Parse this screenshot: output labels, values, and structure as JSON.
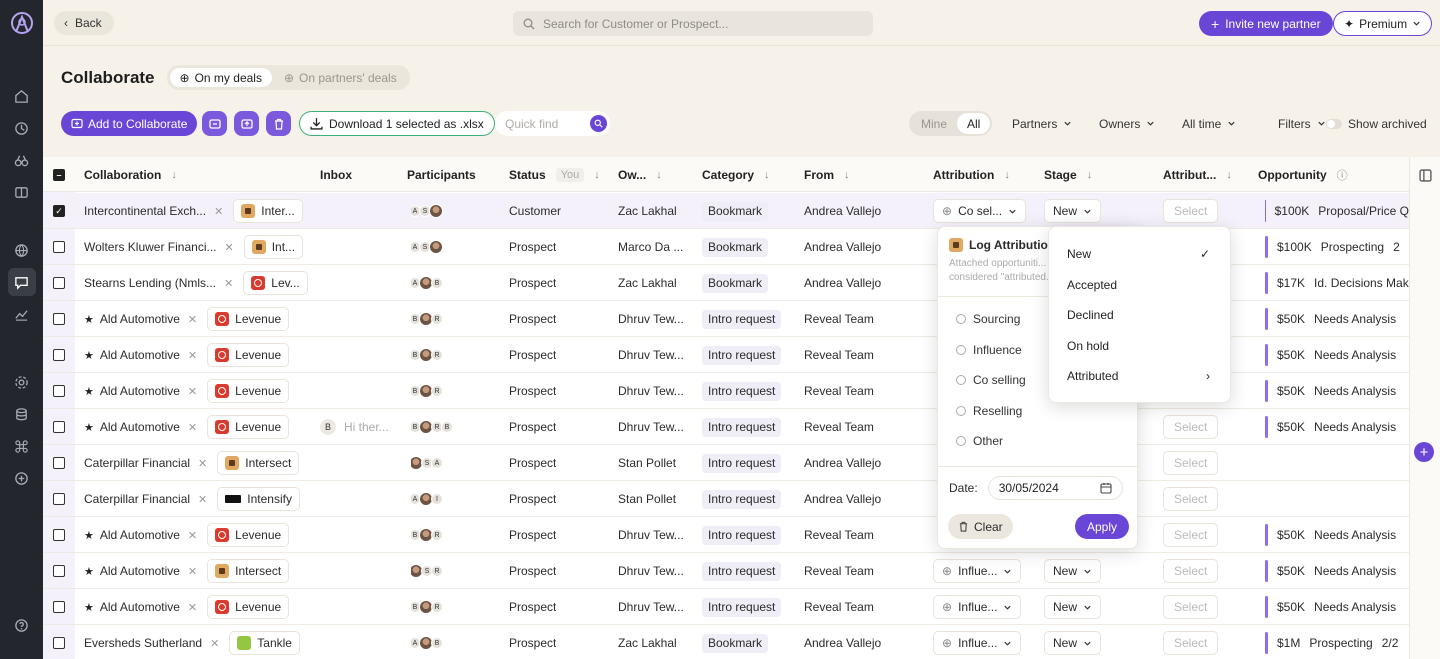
{
  "topbar": {
    "back": "Back",
    "search_placeholder": "Search for Customer or Prospect...",
    "invite": "Invite new partner",
    "premium": "Premium"
  },
  "page": {
    "title": "Collaborate",
    "tabs": [
      {
        "label": "On my deals",
        "active": true
      },
      {
        "label": "On partners' deals",
        "active": false
      }
    ]
  },
  "toolbar": {
    "add": "Add to Collaborate",
    "download": "Download 1 selected as .xlsx",
    "quickfind_placeholder": "Quick find",
    "mine": "Mine",
    "all": "All",
    "partners": "Partners",
    "owners": "Owners",
    "time": "All time",
    "filters": "Filters",
    "archived": "Show archived"
  },
  "columns": {
    "collaboration": "Collaboration",
    "inbox": "Inbox",
    "participants": "Participants",
    "status": "Status",
    "you": "You",
    "owner": "Ow...",
    "category": "Category",
    "from": "From",
    "attribution": "Attribution",
    "stage": "Stage",
    "attributed": "Attribut...",
    "opportunity": "Opportunity"
  },
  "rows": [
    {
      "name": "Intercontinental Exch...",
      "star": false,
      "partner": "Inter...",
      "logo": "int",
      "avatars": [
        "A",
        "S",
        "ph"
      ],
      "status": "Customer",
      "owner": "Zac Lakhal",
      "category": "Bookmark",
      "from": "Andrea Vallejo",
      "attribution": "Co sel...",
      "stage": "New",
      "attributed": "Select",
      "amount": "$100K",
      "opp_stage": "Proposal/Price Q",
      "inbox": "",
      "selected": true
    },
    {
      "name": "Wolters Kluwer Financi...",
      "star": false,
      "partner": "Int...",
      "logo": "int",
      "avatars": [
        "A",
        "S",
        "ph"
      ],
      "status": "Prospect",
      "owner": "Marco Da ...",
      "category": "Bookmark",
      "from": "Andrea Vallejo",
      "attribution": "",
      "stage": "",
      "attributed": "",
      "amount": "$100K",
      "opp_stage": "Prospecting",
      "extra": "2",
      "inbox": "",
      "selected": false
    },
    {
      "name": "Stearns Lending (Nmls...",
      "star": false,
      "partner": "Lev...",
      "logo": "lev",
      "avatars": [
        "A",
        "ph",
        "B"
      ],
      "status": "Prospect",
      "owner": "Zac Lakhal",
      "category": "Bookmark",
      "from": "Andrea Vallejo",
      "attribution": "",
      "stage": "",
      "attributed": "",
      "amount": "$17K",
      "opp_stage": "Id. Decisions Mak",
      "inbox": "",
      "selected": false
    },
    {
      "name": "Ald Automotive",
      "star": true,
      "partner": "Levenue",
      "logo": "lev",
      "avatars": [
        "B",
        "ph",
        "R"
      ],
      "status": "Prospect",
      "owner": "Dhruv Tew...",
      "category": "Intro request",
      "from": "Reveal Team",
      "attribution": "",
      "stage": "",
      "attributed": "",
      "amount": "$50K",
      "opp_stage": "Needs Analysis",
      "inbox": "",
      "selected": false
    },
    {
      "name": "Ald Automotive",
      "star": true,
      "partner": "Levenue",
      "logo": "lev",
      "avatars": [
        "B",
        "ph",
        "R"
      ],
      "status": "Prospect",
      "owner": "Dhruv Tew...",
      "category": "Intro request",
      "from": "Reveal Team",
      "attribution": "",
      "stage": "",
      "attributed": "",
      "amount": "$50K",
      "opp_stage": "Needs Analysis",
      "inbox": "",
      "selected": false
    },
    {
      "name": "Ald Automotive",
      "star": true,
      "partner": "Levenue",
      "logo": "lev",
      "avatars": [
        "B",
        "ph",
        "R"
      ],
      "status": "Prospect",
      "owner": "Dhruv Tew...",
      "category": "Intro request",
      "from": "Reveal Team",
      "attribution": "",
      "stage": "",
      "attributed": "",
      "amount": "$50K",
      "opp_stage": "Needs Analysis",
      "inbox": "",
      "selected": false
    },
    {
      "name": "Ald Automotive",
      "star": true,
      "partner": "Levenue",
      "logo": "lev",
      "avatars": [
        "B",
        "ph",
        "R",
        "B"
      ],
      "status": "Prospect",
      "owner": "Dhruv Tew...",
      "category": "Intro request",
      "from": "Reveal Team",
      "attribution": "",
      "stage": "",
      "attributed": "Select",
      "amount": "$50K",
      "opp_stage": "Needs Analysis",
      "inbox": "Hi ther...",
      "inbox_av": "B",
      "selected": false
    },
    {
      "name": "Caterpillar Financial",
      "star": false,
      "partner": "Intersect",
      "logo": "int",
      "avatars": [
        "ph",
        "S",
        "A"
      ],
      "status": "Prospect",
      "owner": "Stan Pollet",
      "category": "Intro request",
      "from": "Andrea Vallejo",
      "attribution": "",
      "stage": "",
      "attributed": "Select",
      "amount": "",
      "opp_stage": "",
      "inbox": "",
      "selected": false
    },
    {
      "name": "Caterpillar Financial",
      "star": false,
      "partner": "Intensify",
      "logo": "ifs",
      "avatars": [
        "A",
        "ph",
        "I"
      ],
      "status": "Prospect",
      "owner": "Stan Pollet",
      "category": "Intro request",
      "from": "Andrea Vallejo",
      "attribution": "",
      "stage": "",
      "attributed": "Select",
      "amount": "",
      "opp_stage": "",
      "inbox": "",
      "selected": false
    },
    {
      "name": "Ald Automotive",
      "star": true,
      "partner": "Levenue",
      "logo": "lev",
      "avatars": [
        "B",
        "ph",
        "R"
      ],
      "status": "Prospect",
      "owner": "Dhruv Tew...",
      "category": "Intro request",
      "from": "Reveal Team",
      "attribution": "",
      "stage": "",
      "attributed": "Select",
      "amount": "$50K",
      "opp_stage": "Needs Analysis",
      "inbox": "",
      "selected": false
    },
    {
      "name": "Ald Automotive",
      "star": true,
      "partner": "Intersect",
      "logo": "int",
      "avatars": [
        "ph",
        "S",
        "R"
      ],
      "status": "Prospect",
      "owner": "Dhruv Tew...",
      "category": "Intro request",
      "from": "Reveal Team",
      "attribution": "Influe...",
      "stage": "New",
      "attributed": "Select",
      "amount": "$50K",
      "opp_stage": "Needs Analysis",
      "inbox": "",
      "selected": false
    },
    {
      "name": "Ald Automotive",
      "star": true,
      "partner": "Levenue",
      "logo": "lev",
      "avatars": [
        "B",
        "ph",
        "R"
      ],
      "status": "Prospect",
      "owner": "Dhruv Tew...",
      "category": "Intro request",
      "from": "Reveal Team",
      "attribution": "Influe...",
      "stage": "New",
      "attributed": "Select",
      "amount": "$50K",
      "opp_stage": "Needs Analysis",
      "inbox": "",
      "selected": false
    },
    {
      "name": "Eversheds Sutherland",
      "star": false,
      "partner": "Tankle",
      "logo": "tan",
      "avatars": [
        "A",
        "ph",
        "B"
      ],
      "status": "Prospect",
      "owner": "Zac Lakhal",
      "category": "Bookmark",
      "from": "Andrea Vallejo",
      "attribution": "Influe...",
      "stage": "New",
      "attributed": "Select",
      "amount": "$1M",
      "opp_stage": "Prospecting",
      "extra": "2/2",
      "inbox": "",
      "selected": false
    }
  ],
  "attr_popup": {
    "title": "Log Attribution",
    "desc1": "Attached opportuniti...",
    "desc2": "considered \"attributed...",
    "options": [
      "Sourcing",
      "Influence",
      "Co selling",
      "Reselling",
      "Other"
    ],
    "date_label": "Date:",
    "date": "30/05/2024",
    "clear": "Clear",
    "apply": "Apply"
  },
  "stage_popup": {
    "options": [
      {
        "label": "New",
        "checked": true
      },
      {
        "label": "Accepted"
      },
      {
        "label": "Declined"
      },
      {
        "label": "On hold"
      },
      {
        "label": "Attributed",
        "submenu": true
      }
    ]
  }
}
